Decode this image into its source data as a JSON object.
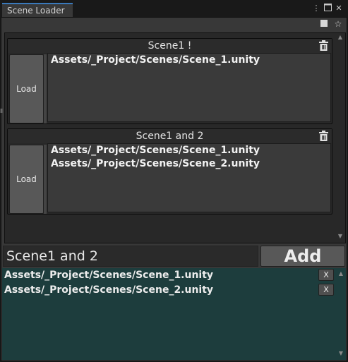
{
  "window": {
    "tab_title": "Scene Loader",
    "menu_icon": "kebab-menu-icon",
    "maximize_icon": "maximize-icon",
    "close_icon": "close-icon"
  },
  "toolbar": {
    "stop_icon": "square-icon",
    "favorite_icon": "star-icon"
  },
  "scene_groups": [
    {
      "title": "Scene1 !",
      "load_label": "Load",
      "paths": [
        "Assets/_Project/Scenes/Scene_1.unity"
      ]
    },
    {
      "title": "Scene1 and 2",
      "load_label": "Load",
      "paths": [
        "Assets/_Project/Scenes/Scene_1.unity",
        "Assets/_Project/Scenes/Scene_2.unity"
      ]
    }
  ],
  "new_group": {
    "name_value": "Scene1 and 2",
    "add_label": "Add"
  },
  "pending": {
    "items": [
      {
        "path": "Assets/_Project/Scenes/Scene_1.unity",
        "remove_label": "X"
      },
      {
        "path": "Assets/_Project/Scenes/Scene_2.unity",
        "remove_label": "X"
      }
    ]
  },
  "colors": {
    "tab_accent": "#3a79bb",
    "pending_background": "#1d3d3d"
  }
}
